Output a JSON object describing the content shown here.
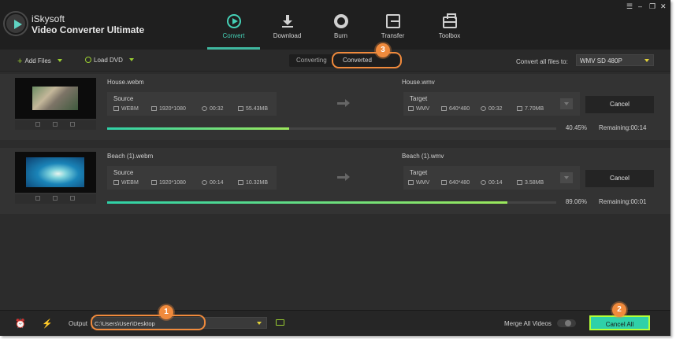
{
  "app": {
    "brand_line1": "iSkysoft",
    "brand_line2": "Video Converter Ultimate",
    "logo_icon": "play-logo-icon"
  },
  "nav": [
    {
      "label": "Convert",
      "icon": "convert-icon",
      "active": true
    },
    {
      "label": "Download",
      "icon": "download-icon"
    },
    {
      "label": "Burn",
      "icon": "burn-disc-icon"
    },
    {
      "label": "Transfer",
      "icon": "transfer-icon"
    },
    {
      "label": "Toolbox",
      "icon": "toolbox-icon"
    }
  ],
  "window_controls": {
    "menu": "☰",
    "minimize": "–",
    "restore": "❐",
    "close": "✕"
  },
  "toolbar": {
    "add_files": "Add Files",
    "load_dvd": "Load DVD",
    "tabs": [
      "Converting",
      "Converted"
    ],
    "convert_all_label": "Convert all files to:",
    "format": "WMV SD 480P"
  },
  "items": [
    {
      "source_name": "House.webm",
      "target_name": "House.wmv",
      "source": {
        "label": "Source",
        "format": "WEBM",
        "resolution": "1920*1080",
        "duration": "00:32",
        "size": "55.43MB"
      },
      "target": {
        "label": "Target",
        "format": "WMV",
        "resolution": "640*480",
        "duration": "00:32",
        "size": "7.70MB"
      },
      "cancel": "Cancel",
      "progress": 0.4045,
      "percent": "40.45%",
      "remaining": "Remaining:00:14"
    },
    {
      "source_name": "Beach (1).webm",
      "target_name": "Beach (1).wmv",
      "source": {
        "label": "Source",
        "format": "WEBM",
        "resolution": "1920*1080",
        "duration": "00:14",
        "size": "10.32MB"
      },
      "target": {
        "label": "Target",
        "format": "WMV",
        "resolution": "640*480",
        "duration": "00:14",
        "size": "3.58MB"
      },
      "cancel": "Cancel",
      "progress": 0.8906,
      "percent": "89.06%",
      "remaining": "Remaining:00:01"
    }
  ],
  "footer": {
    "output_label": "Output",
    "output_path": "C:\\Users\\User\\Desktop",
    "merge_label": "Merge All Videos",
    "cancel_all": "Cancel All"
  },
  "callouts": [
    "1",
    "2",
    "3"
  ],
  "colors": {
    "accent": "#45d1b7",
    "highlight": "#f08a3c",
    "cancel_all_bg": "#2fd1a8"
  }
}
